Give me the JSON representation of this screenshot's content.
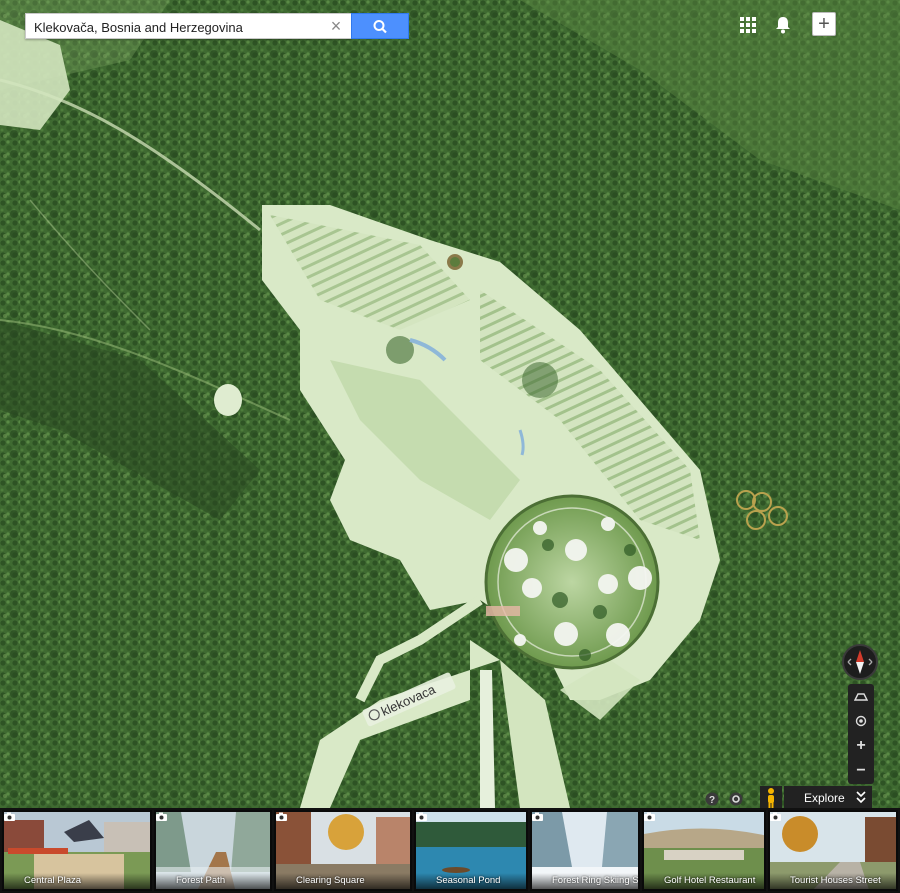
{
  "search": {
    "value": "Klekovača, Bosnia and Herzegovina"
  },
  "map": {
    "location_label": "klekovaca"
  },
  "explore": {
    "label": "Explore"
  },
  "photos": [
    {
      "label": "Central Plaza"
    },
    {
      "label": "Forest Path"
    },
    {
      "label": "Clearing Square"
    },
    {
      "label": "Seasonal Pond"
    },
    {
      "label": "Forest Ring Skiing Slope"
    },
    {
      "label": "Golf Hotel Restaurant"
    },
    {
      "label": "Tourist Houses Street"
    }
  ],
  "colors": {
    "forest": "#3d6630",
    "clearing": "#d7e8c4",
    "search_blue": "#4d90fe",
    "compass_red": "#d23b2c"
  }
}
